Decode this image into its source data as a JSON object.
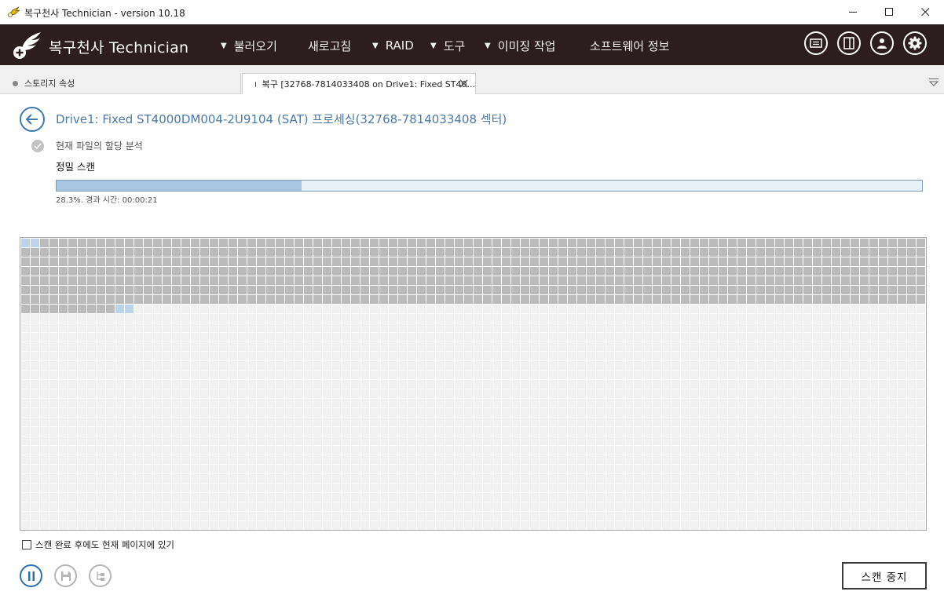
{
  "window": {
    "title": "복구천사 Technician - version 10.18",
    "controls": [
      "minimize",
      "maximize",
      "close"
    ]
  },
  "header": {
    "brand": "복구천사 Technician",
    "menu": [
      {
        "label": "불러오기",
        "has_dropdown": true
      },
      {
        "label": "새로고침",
        "has_dropdown": false
      },
      {
        "label": "RAID",
        "has_dropdown": true
      },
      {
        "label": "도구",
        "has_dropdown": true
      },
      {
        "label": "이미징 작업",
        "has_dropdown": true
      },
      {
        "label": "소프트웨어 정보",
        "has_dropdown": false
      }
    ],
    "icon_buttons": [
      "card-icon",
      "panel-icon",
      "user-icon",
      "gear-icon"
    ],
    "colors": {
      "background": "#2c1e1e",
      "text": "#ffffff"
    }
  },
  "tabs": [
    {
      "label": "스토리지 속성",
      "active": false,
      "dot_color": "#888888"
    },
    {
      "label": "복구 [32768-7814033408 on Drive1: Fixed ST40...",
      "active": true,
      "dot_color": "#8b1a1a"
    }
  ],
  "main": {
    "drive_title": "Drive1: Fixed ST4000DM004-2U9104 (SAT) 프로세싱(32768-7814033408 섹터)",
    "steps": [
      {
        "label": "현재 파일의 할당 분석",
        "status": "done"
      },
      {
        "label": "정밀 스캔",
        "status": "active"
      }
    ],
    "progress": {
      "percent": 28.3,
      "text": "28.3%. 경과 시간: 00:00:21"
    },
    "block_map": {
      "columns": 96,
      "rows": 31,
      "scanned_blocks": 682,
      "in_progress_blocks": [
        0,
        1,
        682,
        683
      ],
      "colors": {
        "scanned": "#bbbbbb",
        "in_progress": "#bcd4ea",
        "unscanned": "#f1f1f1"
      }
    },
    "keep_page_checkbox": {
      "label": "스캔 완료 후에도 현재 페이지에 있기",
      "checked": false
    },
    "bottom_buttons": [
      "pause-icon",
      "save-icon",
      "tree-icon"
    ],
    "stop_button": "스캔 중지"
  }
}
